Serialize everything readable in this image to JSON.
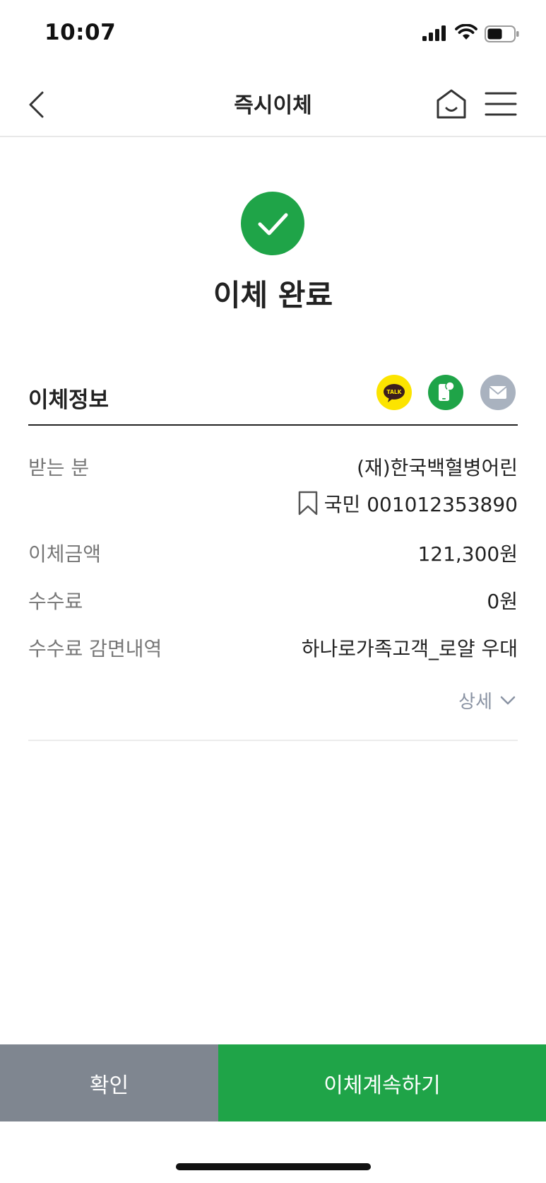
{
  "status_bar": {
    "time": "10:07"
  },
  "header": {
    "title": "즉시이체"
  },
  "result": {
    "title": "이체 완료"
  },
  "section": {
    "title": "이체정보",
    "share": {
      "kakao_label": "TALK"
    }
  },
  "details": {
    "recipient": {
      "label": "받는 분",
      "name": "(재)한국백혈병어린",
      "account": "국민 001012353890"
    },
    "amount": {
      "label": "이체금액",
      "value": "121,300원"
    },
    "fee": {
      "label": "수수료",
      "value": "0원"
    },
    "fee_waiver": {
      "label": "수수료 감면내역",
      "value": "하나로가족고객_로얄 우대"
    },
    "more_label": "상세"
  },
  "actions": {
    "confirm_label": "확인",
    "continue_label": "이체계속하기"
  },
  "colors": {
    "accent": "#1fa448",
    "secondary": "#7f8690",
    "kakao": "#fce400",
    "mail": "#a9b2bf"
  }
}
